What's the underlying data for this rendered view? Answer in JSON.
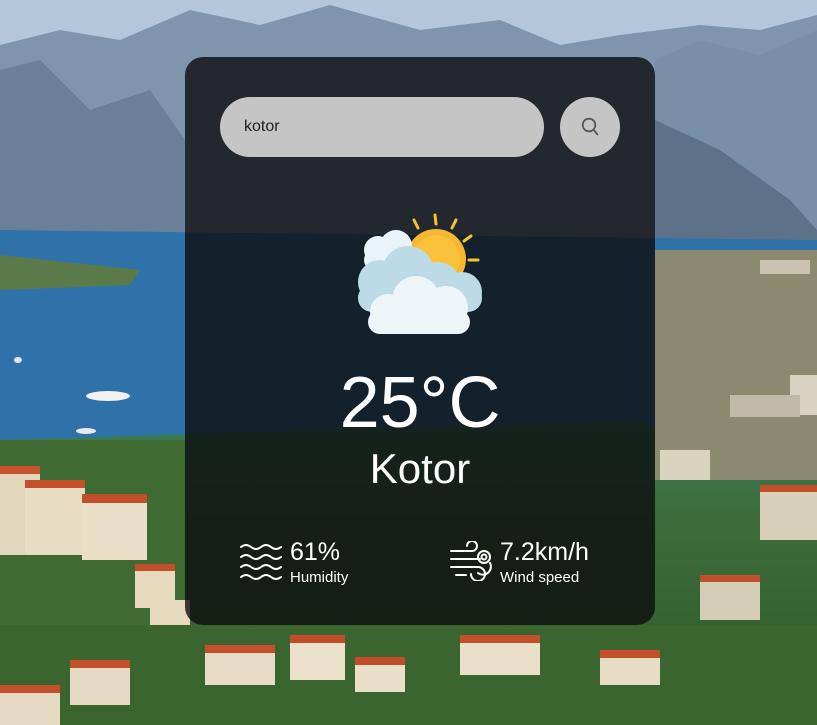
{
  "search": {
    "value": "kotor",
    "button_icon": "search-icon"
  },
  "weather": {
    "icon": "partly-cloudy-icon",
    "temperature": "25°C",
    "city": "Kotor"
  },
  "humidity": {
    "icon": "humidity-waves-icon",
    "value": "61%",
    "label": "Humidity"
  },
  "wind": {
    "icon": "wind-icon",
    "value": "7.2km/h",
    "label": "Wind speed"
  },
  "colors": {
    "card_background": "#0c0c0e",
    "input_background": "#c5c5c5",
    "text": "#ffffff",
    "sun": "#f7b731",
    "cloud": "#d6edf5"
  }
}
